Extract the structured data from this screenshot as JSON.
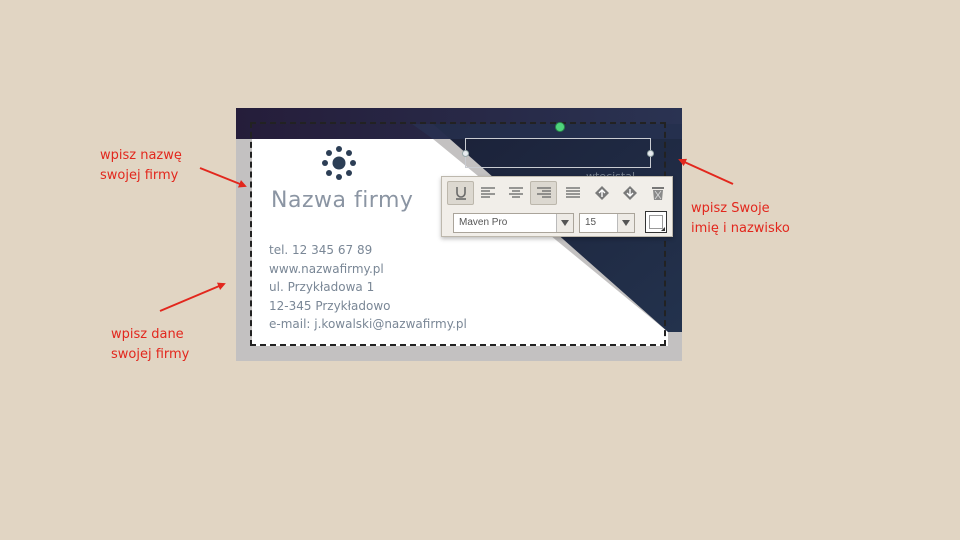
{
  "card": {
    "company_name": "Nazwa firmy",
    "info_lines": [
      "tel. 12 345 67 89",
      "www.nazwafirmy.pl",
      "ul. Przykładowa 1",
      "12-345 Przykładowo",
      "e-mail: j.kowalski@nazwafirmy.pl"
    ],
    "ghost_text": "wtecistal"
  },
  "toolbar": {
    "buttons": [
      "underline-icon",
      "align-left-icon",
      "align-center-icon",
      "align-right-icon",
      "align-justify-icon",
      "bring-forward-icon",
      "send-backward-icon",
      "trash-icon"
    ],
    "font_family": "Maven Pro",
    "font_size": "15"
  },
  "annotations": {
    "company_name_hint": [
      "wpisz nazwę",
      "swojej firmy"
    ],
    "name_hint": [
      "wpisz Swoje",
      "imię i nazwisko"
    ],
    "company_data_hint": [
      "wpisz dane",
      "swojej firmy"
    ]
  },
  "colors": {
    "background": "#e1d5c3",
    "card_dark": "#1e2a44",
    "logo": "#2c3e55",
    "annotation": "#e2271d"
  }
}
